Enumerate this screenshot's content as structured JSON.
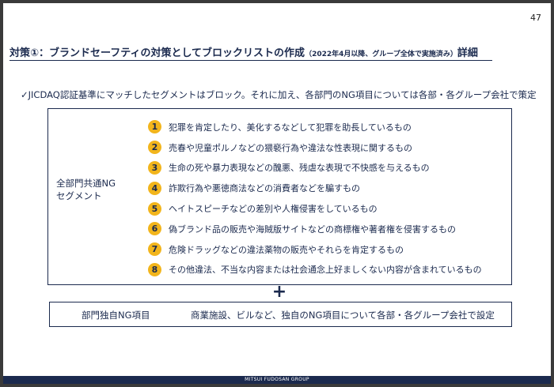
{
  "page_number": "47",
  "title": {
    "main": "対策①：ブランドセーフティの対策としてブロックリストの作成",
    "sub": "（2022年4月以降、グループ全体で実施済み）",
    "suffix": "詳細"
  },
  "lead": "✓JICDAQ認証基準にマッチしたセグメントはブロック。それに加え、各部門のNG項目については各部・各グループ会社で策定",
  "common_segment": {
    "label_line1": "全部門共通NG",
    "label_line2": "セグメント",
    "items": [
      {
        "num": "1",
        "text": "犯罪を肯定したり、美化するなどして犯罪を助長しているもの"
      },
      {
        "num": "2",
        "text": "売春や児童ポルノなどの猥褻行為や違法な性表現に関するもの"
      },
      {
        "num": "3",
        "text": "生命の死や暴力表現などの醜悪、残虐な表現で不快感を与えるもの"
      },
      {
        "num": "4",
        "text": "詐欺行為や悪徳商法などの消費者などを騙すもの"
      },
      {
        "num": "5",
        "text": "ヘイトスピーチなどの差別や人権侵害をしているもの"
      },
      {
        "num": "6",
        "text": "偽ブランド品の販売や海賊版サイトなどの商標権や著者権を侵害するもの"
      },
      {
        "num": "7",
        "text": "危険ドラッグなどの違法薬物の販売やそれらを肯定するもの"
      },
      {
        "num": "8",
        "text": "その他違法、不当な内容または社会通念上好ましくない内容が含まれているもの"
      }
    ]
  },
  "plus": "+",
  "dept_specific": {
    "label": "部門独自NG項目",
    "text": "商業施設、ビルなど、独自のNG項目について各部・各グループ会社で設定"
  },
  "footer": "MITSUI FUDOSAN GROUP",
  "colors": {
    "navy": "#1b2a4e",
    "badge": "#f2b51c"
  }
}
